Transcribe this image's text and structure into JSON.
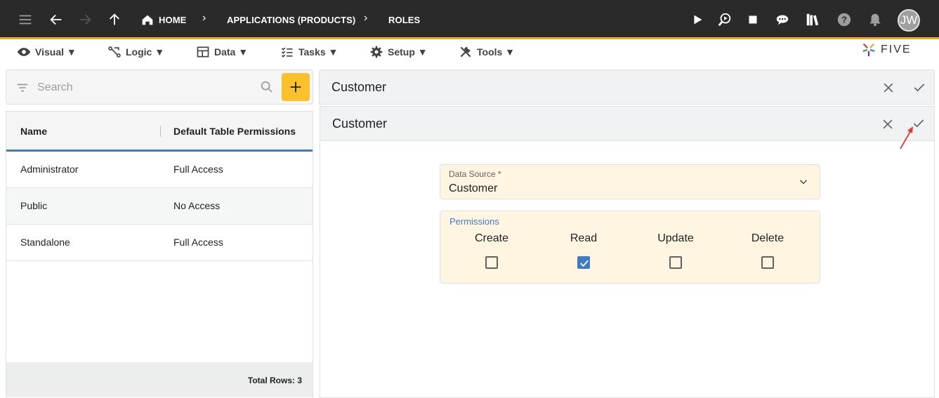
{
  "topbar": {
    "breadcrumbs": [
      {
        "label": "HOME"
      },
      {
        "label": "APPLICATIONS (PRODUCTS)"
      },
      {
        "label": "ROLES"
      }
    ],
    "avatar_initials": "JW",
    "icons": [
      "menu-icon",
      "back-arrow-icon",
      "forward-arrow-icon",
      "up-arrow-icon",
      "home-icon",
      "play-icon",
      "search-debug-icon",
      "stop-icon",
      "chat-icon",
      "library-icon",
      "help-icon",
      "bell-icon"
    ]
  },
  "menubar": {
    "items": [
      {
        "label": "Visual ▼",
        "icon": "eye-icon"
      },
      {
        "label": "Logic ▼",
        "icon": "logic-icon"
      },
      {
        "label": "Data ▼",
        "icon": "table-icon"
      },
      {
        "label": "Tasks ▼",
        "icon": "tasks-icon"
      },
      {
        "label": "Setup ▼",
        "icon": "gear-icon"
      },
      {
        "label": "Tools ▼",
        "icon": "tools-icon"
      }
    ],
    "logo_text": "FIVE"
  },
  "left": {
    "search_placeholder": "Search",
    "columns": [
      "Name",
      "Default Table Permissions"
    ],
    "rows": [
      {
        "name": "Administrator",
        "permission": "Full Access"
      },
      {
        "name": "Public",
        "permission": "No Access"
      },
      {
        "name": "Standalone",
        "permission": "Full Access"
      }
    ],
    "footer": "Total Rows: 3"
  },
  "panel1": {
    "title": "Customer"
  },
  "panel2": {
    "title": "Customer",
    "data_source_label": "Data Source *",
    "data_source_value": "Customer",
    "permissions_label": "Permissions",
    "permissions": [
      {
        "label": "Create",
        "checked": false
      },
      {
        "label": "Read",
        "checked": true
      },
      {
        "label": "Update",
        "checked": false
      },
      {
        "label": "Delete",
        "checked": false
      }
    ]
  },
  "colors": {
    "accent": "#f5a623",
    "primary": "#3f7bc6",
    "add_button": "#fbc02d",
    "field_bg": "#fff5e1",
    "annotation": "#e53935"
  }
}
